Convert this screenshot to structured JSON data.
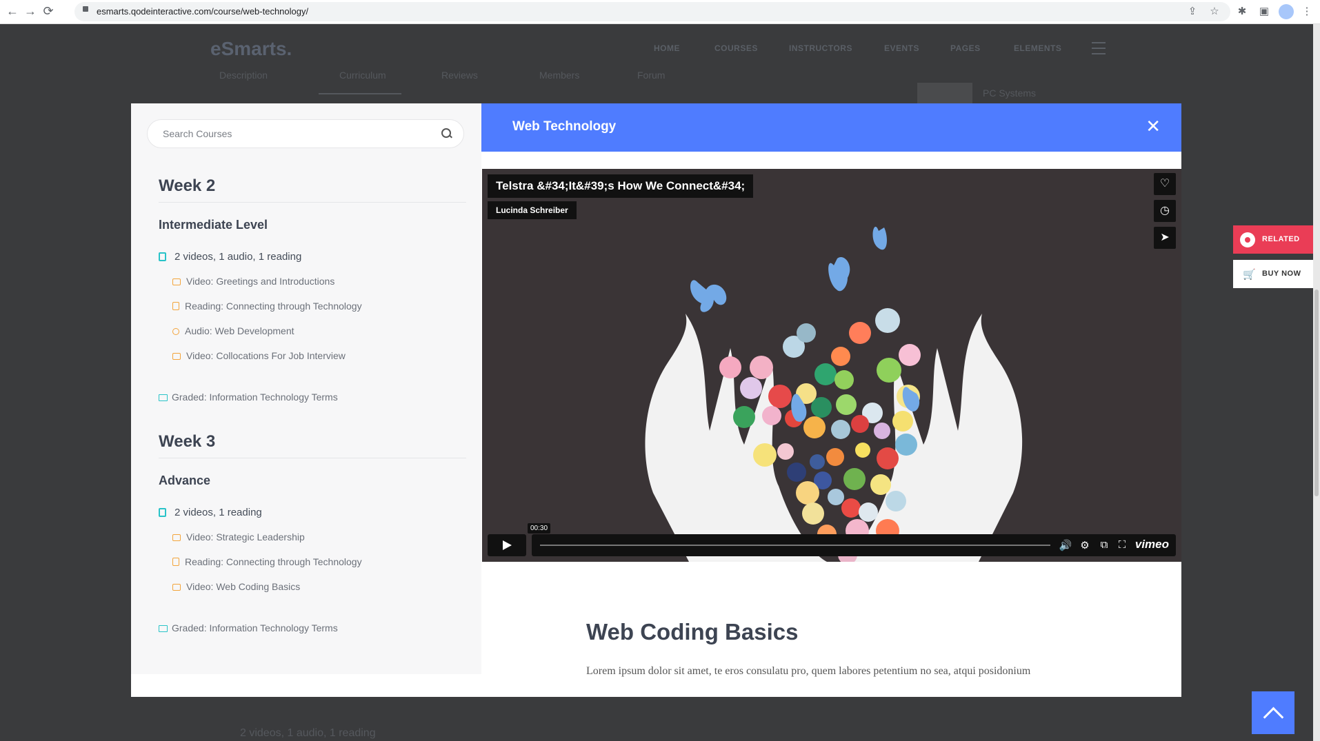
{
  "browser": {
    "url": "esmarts.qodeinteractive.com/course/web-technology/",
    "back": "←",
    "forward": "→",
    "reload": "⟳",
    "share": "⇪",
    "star": "☆",
    "ext": "✱",
    "sidepanel": "▣",
    "menu": "⋮"
  },
  "site": {
    "logo": "eSmarts",
    "logo_dot": ".",
    "nav": [
      "HOME",
      "COURSES",
      "INSTRUCTORS",
      "EVENTS",
      "PAGES",
      "ELEMENTS"
    ],
    "tabs": [
      "Description",
      "Curriculum",
      "Reviews",
      "Members",
      "Forum"
    ],
    "bg_text": "PC Systems",
    "bg_bottom": "2 videos, 1 audio, 1 reading"
  },
  "sidebar": {
    "search_placeholder": "Search Courses",
    "weeks": [
      {
        "title": "Week 2",
        "level": "Intermediate Level",
        "summary": "2 videos, 1 audio, 1 reading",
        "lessons": [
          {
            "icon": "video-icon",
            "label": "Video: Greetings and Introductions"
          },
          {
            "icon": "reading-icon",
            "label": "Reading: Connecting through Technology"
          },
          {
            "icon": "audio-icon",
            "label": "Audio: Web Development"
          },
          {
            "icon": "video-icon",
            "label": "Video: Collocations For Job Interview"
          }
        ],
        "graded": "Graded: Information Technology Terms"
      },
      {
        "title": "Week 3",
        "level": "Advance",
        "summary": "2 videos, 1 reading",
        "lessons": [
          {
            "icon": "video-icon",
            "label": "Video: Strategic Leadership"
          },
          {
            "icon": "reading-icon",
            "label": "Reading: Connecting through Technology"
          },
          {
            "icon": "video-icon",
            "label": "Video: Web Coding Basics"
          }
        ],
        "graded": "Graded: Information Technology Terms"
      }
    ]
  },
  "modal": {
    "title": "Web Technology",
    "close": "✕"
  },
  "video": {
    "title": "Telstra &#34;It&#39;s How We Connect&#34;",
    "author": "Lucinda Schreiber",
    "time": "00:30",
    "brand": "vimeo",
    "heart": "♡",
    "clock": "◷",
    "send": "➤",
    "volume": "🔊",
    "settings": "⚙",
    "pip": "⧉",
    "fullscreen": "⛶"
  },
  "lesson": {
    "title": "Web Coding Basics",
    "text": "Lorem ipsum dolor sit amet, te eros consulatu pro, quem labores petentium no sea, atqui posidonium"
  },
  "side_buttons": {
    "related": "RELATED",
    "buy_now": "BUY NOW",
    "cart": "🛒"
  },
  "colors": {
    "accent": "#4f7cff",
    "related": "#ea3d56",
    "lesson_icon": "#f3a43b",
    "summary_icon": "#28c3c8"
  }
}
